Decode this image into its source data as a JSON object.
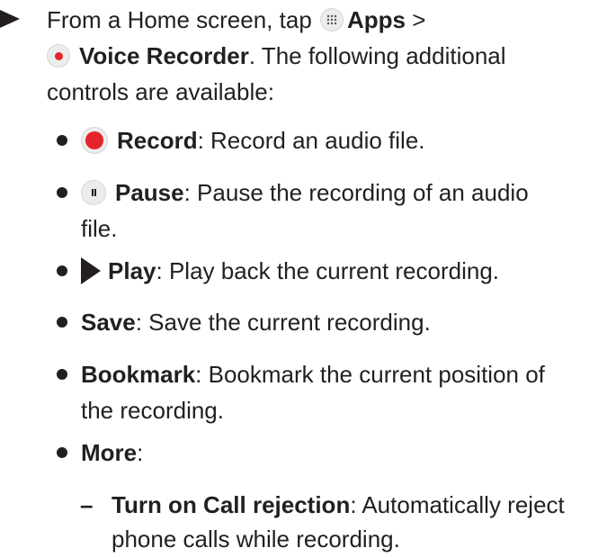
{
  "intro": {
    "prefix": "From a Home screen, tap",
    "apps_label": "Apps",
    "sep": ">",
    "voice_label": "Voice Recorder",
    "rest": ". The following additional",
    "line3": "controls are available:"
  },
  "controls": {
    "record": {
      "label": "Record",
      "desc": ": Record an audio file."
    },
    "pause": {
      "label": "Pause",
      "desc_1": ": Pause the recording of an audio",
      "desc_2": "file."
    },
    "play": {
      "label": "Play",
      "desc": ": Play back the current recording."
    },
    "save": {
      "label": "Save",
      "desc": ": Save the current recording."
    },
    "bookmark": {
      "label": "Bookmark",
      "desc_1": ": Bookmark the current position of",
      "desc_2": "the recording."
    },
    "more": {
      "label": "More",
      "desc": ":"
    }
  },
  "more_items": {
    "call_rejection": {
      "dash": "–",
      "label": "Turn on Call rejection",
      "desc_1": ": Automatically reject",
      "desc_2": "phone calls while recording."
    }
  },
  "icons": {
    "arrow": "right-triangle-arrow",
    "apps": "apps-grid-icon",
    "voice_recorder": "voice-recorder-icon",
    "record": "record-icon",
    "pause": "pause-icon",
    "play": "play-icon"
  },
  "colors": {
    "text": "#231f20",
    "record_red": "#e4232a",
    "icon_bg": "#ececec"
  }
}
